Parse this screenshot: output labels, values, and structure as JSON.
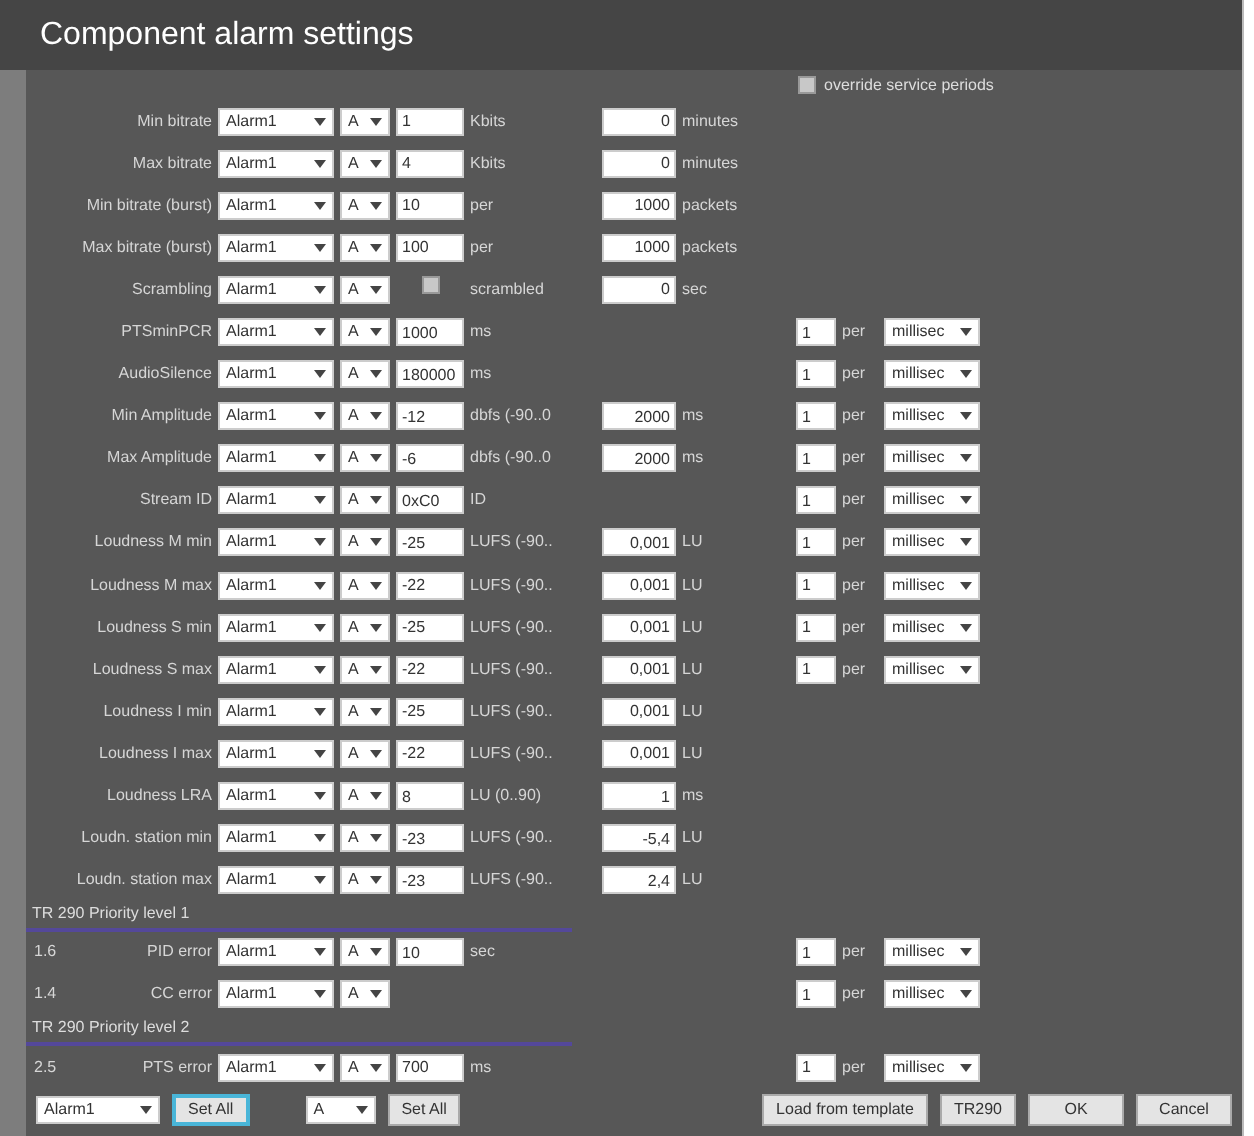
{
  "window": {
    "title": "Component alarm settings"
  },
  "override": {
    "label": "override service periods",
    "checked": false
  },
  "groups": [
    {
      "rows": [
        {
          "label": "Min bitrate",
          "alarm": "Alarm1",
          "grade": "A",
          "value": "1",
          "unit": "Kbits",
          "count": "0",
          "count_unit": "minutes"
        },
        {
          "label": "Max bitrate",
          "alarm": "Alarm1",
          "grade": "A",
          "value": "4",
          "unit": "Kbits",
          "count": "0",
          "count_unit": "minutes"
        },
        {
          "label": "Min bitrate (burst)",
          "alarm": "Alarm1",
          "grade": "A",
          "value": "10",
          "unit": "per",
          "count": "1000",
          "count_unit": "packets"
        },
        {
          "label": "Max bitrate (burst)",
          "alarm": "Alarm1",
          "grade": "A",
          "value": "100",
          "unit": "per",
          "count": "1000",
          "count_unit": "packets"
        },
        {
          "label": "Scrambling",
          "alarm": "Alarm1",
          "grade": "A",
          "kind": "checkbox",
          "checked": false,
          "unit": "scrambled",
          "count": "0",
          "count_unit": "sec"
        },
        {
          "label": "PTSminPCR",
          "alarm": "Alarm1",
          "grade": "A",
          "value": "1000",
          "unit": "ms",
          "rate": {
            "value": "1",
            "per": "per",
            "period": "millisec"
          }
        },
        {
          "label": "AudioSilence",
          "alarm": "Alarm1",
          "grade": "A",
          "value": "180000",
          "unit": "ms",
          "rate": {
            "value": "1",
            "per": "per",
            "period": "millisec"
          }
        },
        {
          "label": "Min Amplitude",
          "alarm": "Alarm1",
          "grade": "A",
          "value": "-12",
          "unit": "dbfs (-90..0",
          "count": "2000",
          "count_unit": "ms",
          "rate": {
            "value": "1",
            "per": "per",
            "period": "millisec"
          }
        },
        {
          "label": "Max Amplitude",
          "alarm": "Alarm1",
          "grade": "A",
          "value": "-6",
          "unit": "dbfs (-90..0",
          "count": "2000",
          "count_unit": "ms",
          "rate": {
            "value": "1",
            "per": "per",
            "period": "millisec"
          }
        },
        {
          "label": "Stream ID",
          "alarm": "Alarm1",
          "grade": "A",
          "value": "0xC0",
          "unit": "ID",
          "rate": {
            "value": "1",
            "per": "per",
            "period": "millisec"
          }
        },
        {
          "label": "Loudness M min",
          "alarm": "Alarm1",
          "grade": "A",
          "value": "-25",
          "unit": "LUFS (-90..",
          "count": "0,001",
          "count_unit": "LU",
          "rate": {
            "value": "1",
            "per": "per",
            "period": "millisec"
          }
        },
        {
          "label": "Loudness M max",
          "alarm": "Alarm1",
          "grade": "A",
          "value": "-22",
          "unit": "LUFS (-90..",
          "count": "0,001",
          "count_unit": "LU",
          "rate": {
            "value": "1",
            "per": "per",
            "period": "millisec"
          }
        },
        {
          "label": "Loudness S min",
          "alarm": "Alarm1",
          "grade": "A",
          "value": "-25",
          "unit": "LUFS (-90..",
          "count": "0,001",
          "count_unit": "LU",
          "rate": {
            "value": "1",
            "per": "per",
            "period": "millisec"
          }
        },
        {
          "label": "Loudness S max",
          "alarm": "Alarm1",
          "grade": "A",
          "value": "-22",
          "unit": "LUFS (-90..",
          "count": "0,001",
          "count_unit": "LU",
          "rate": {
            "value": "1",
            "per": "per",
            "period": "millisec"
          }
        },
        {
          "label": "Loudness I min",
          "alarm": "Alarm1",
          "grade": "A",
          "value": "-25",
          "unit": "LUFS (-90..",
          "count": "0,001",
          "count_unit": "LU"
        },
        {
          "label": "Loudness I max",
          "alarm": "Alarm1",
          "grade": "A",
          "value": "-22",
          "unit": "LUFS (-90..",
          "count": "0,001",
          "count_unit": "LU"
        },
        {
          "label": "Loudness LRA",
          "alarm": "Alarm1",
          "grade": "A",
          "value": "8",
          "unit": "LU (0..90)",
          "count": "1",
          "count_unit": "ms"
        },
        {
          "label": "Loudn. station min",
          "alarm": "Alarm1",
          "grade": "A",
          "value": "-23",
          "unit": "LUFS (-90..",
          "count": "-5,4",
          "count_unit": "LU"
        },
        {
          "label": "Loudn. station max",
          "alarm": "Alarm1",
          "grade": "A",
          "value": "-23",
          "unit": "LUFS (-90..",
          "count": "2,4",
          "count_unit": "LU"
        }
      ]
    },
    {
      "heading": "TR 290 Priority level 1",
      "rows": [
        {
          "code": "1.6",
          "label": "PID error",
          "alarm": "Alarm1",
          "grade": "A",
          "value": "10",
          "unit": "sec",
          "rate": {
            "value": "1",
            "per": "per",
            "period": "millisec"
          }
        },
        {
          "code": "1.4",
          "label": "CC error",
          "alarm": "Alarm1",
          "grade": "A",
          "rate": {
            "value": "1",
            "per": "per",
            "period": "millisec"
          }
        }
      ]
    },
    {
      "heading": "TR 290 Priority level 2",
      "rows": [
        {
          "code": "2.5",
          "label": "PTS error",
          "alarm": "Alarm1",
          "grade": "A",
          "value": "700",
          "unit": "ms",
          "rate": {
            "value": "1",
            "per": "per",
            "period": "millisec"
          }
        }
      ]
    }
  ],
  "footer": {
    "alarm_select": "Alarm1",
    "alarm_set_all": {
      "label": "Set All",
      "focused": true
    },
    "grade_select": "A",
    "grade_set_all": {
      "label": "Set All",
      "focused": false
    },
    "buttons": [
      "Load from template",
      "TR290",
      "OK",
      "Cancel"
    ]
  }
}
